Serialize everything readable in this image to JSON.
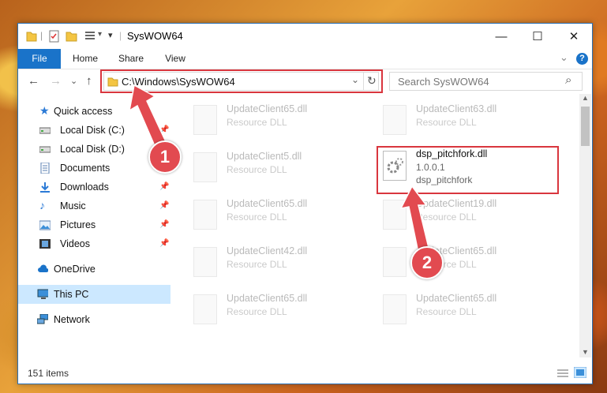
{
  "window": {
    "title": "SysWOW64",
    "minimize_glyph": "—",
    "maximize_glyph": "☐",
    "close_glyph": "✕"
  },
  "ribbon": {
    "tabs": [
      "File",
      "Home",
      "Share",
      "View"
    ],
    "expand_glyph": "⌄",
    "help_glyph": "?"
  },
  "nav": {
    "back_glyph": "←",
    "forward_glyph": "→",
    "recent_glyph": "⌄",
    "up_glyph": "↑",
    "address": "C:\\Windows\\SysWOW64",
    "dropdown_glyph": "⌄",
    "refresh_glyph": "↻",
    "search_placeholder": "Search SysWOW64",
    "search_glyph": "⌕"
  },
  "sidebar": {
    "items": [
      {
        "label": "Quick access",
        "icon": "star-icon",
        "pinned": false
      },
      {
        "label": "Local Disk (C:)",
        "icon": "drive-icon",
        "pinned": true
      },
      {
        "label": "Local Disk (D:)",
        "icon": "drive-icon",
        "pinned": false
      },
      {
        "label": "Documents",
        "icon": "documents-icon",
        "pinned": false
      },
      {
        "label": "Downloads",
        "icon": "download-icon",
        "pinned": true
      },
      {
        "label": "Music",
        "icon": "music-icon",
        "pinned": true
      },
      {
        "label": "Pictures",
        "icon": "pictures-icon",
        "pinned": true
      },
      {
        "label": "Videos",
        "icon": "videos-icon",
        "pinned": true
      },
      {
        "label": "OneDrive",
        "icon": "cloud-icon",
        "pinned": false
      },
      {
        "label": "This PC",
        "icon": "computer-icon",
        "pinned": false,
        "selected": true
      },
      {
        "label": "Network",
        "icon": "network-icon",
        "pinned": false
      }
    ],
    "pin_glyph": "📌"
  },
  "files": [
    {
      "name": "UpdateClient65.dll",
      "type": "Resource DLL"
    },
    {
      "name": "UpdateClient63.dll",
      "type": "Resource DLL"
    },
    {
      "name": "UpdateClient5.dll",
      "type": "Resource DLL"
    },
    {
      "name": "dsp_pitchfork.dll",
      "version": "1.0.0.1",
      "description": "dsp_pitchfork",
      "selected": true
    },
    {
      "name": "UpdateClient65.dll",
      "type": "Resource DLL"
    },
    {
      "name": "UpdateClient19.dll",
      "type": "Resource DLL"
    },
    {
      "name": "UpdateClient42.dll",
      "type": "Resource DLL"
    },
    {
      "name": "UpdateClient65.dll",
      "type": "Resource DLL"
    },
    {
      "name": "UpdateClient65.dll",
      "type": "Resource DLL"
    },
    {
      "name": "UpdateClient65.dll",
      "type": "Resource DLL"
    }
  ],
  "status": {
    "item_count": "151 items"
  },
  "annotations": {
    "step1": "1",
    "step2": "2"
  },
  "colors": {
    "accent": "#1a73c9",
    "highlight_red": "#d9363e",
    "selected_bg": "#cce8ff",
    "folder_yellow": "#f4c542"
  }
}
